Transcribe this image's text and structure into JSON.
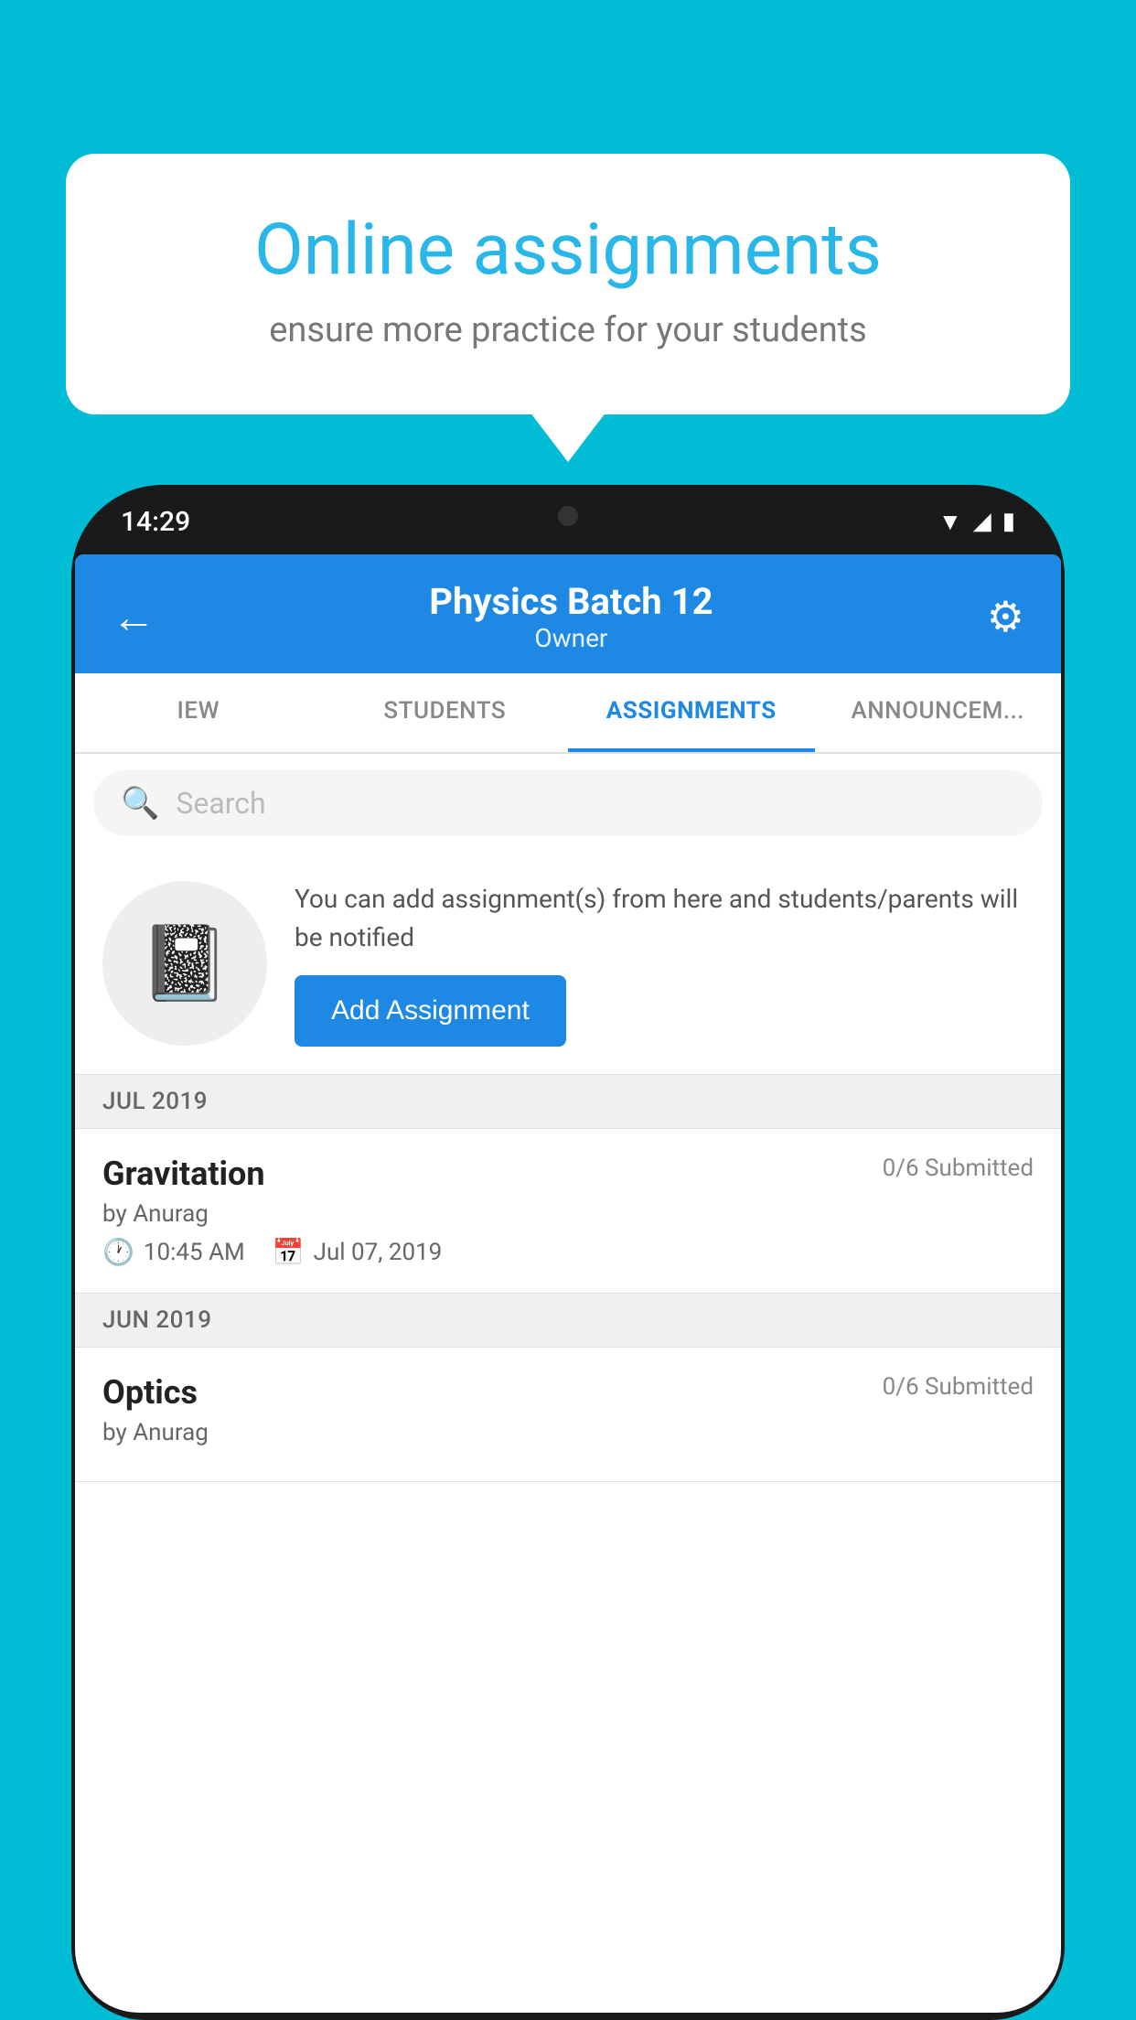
{
  "background_color": "#00bcd4",
  "bubble": {
    "title": "Online assignments",
    "subtitle": "ensure more practice for your students"
  },
  "phone": {
    "status_time": "14:29",
    "header": {
      "title": "Physics Batch 12",
      "subtitle": "Owner"
    },
    "tabs": [
      {
        "label": "IEW",
        "active": false
      },
      {
        "label": "STUDENTS",
        "active": false
      },
      {
        "label": "ASSIGNMENTS",
        "active": true
      },
      {
        "label": "ANNOUNCEM...",
        "active": false
      }
    ],
    "search": {
      "placeholder": "Search"
    },
    "promo": {
      "text": "You can add assignment(s) from here and students/parents will be notified",
      "button_label": "Add Assignment"
    },
    "sections": [
      {
        "month": "JUL 2019",
        "assignments": [
          {
            "name": "Gravitation",
            "submitted": "0/6 Submitted",
            "by": "by Anurag",
            "time": "10:45 AM",
            "date": "Jul 07, 2019"
          }
        ]
      },
      {
        "month": "JUN 2019",
        "assignments": [
          {
            "name": "Optics",
            "submitted": "0/6 Submitted",
            "by": "by Anurag",
            "time": "",
            "date": ""
          }
        ]
      }
    ]
  }
}
